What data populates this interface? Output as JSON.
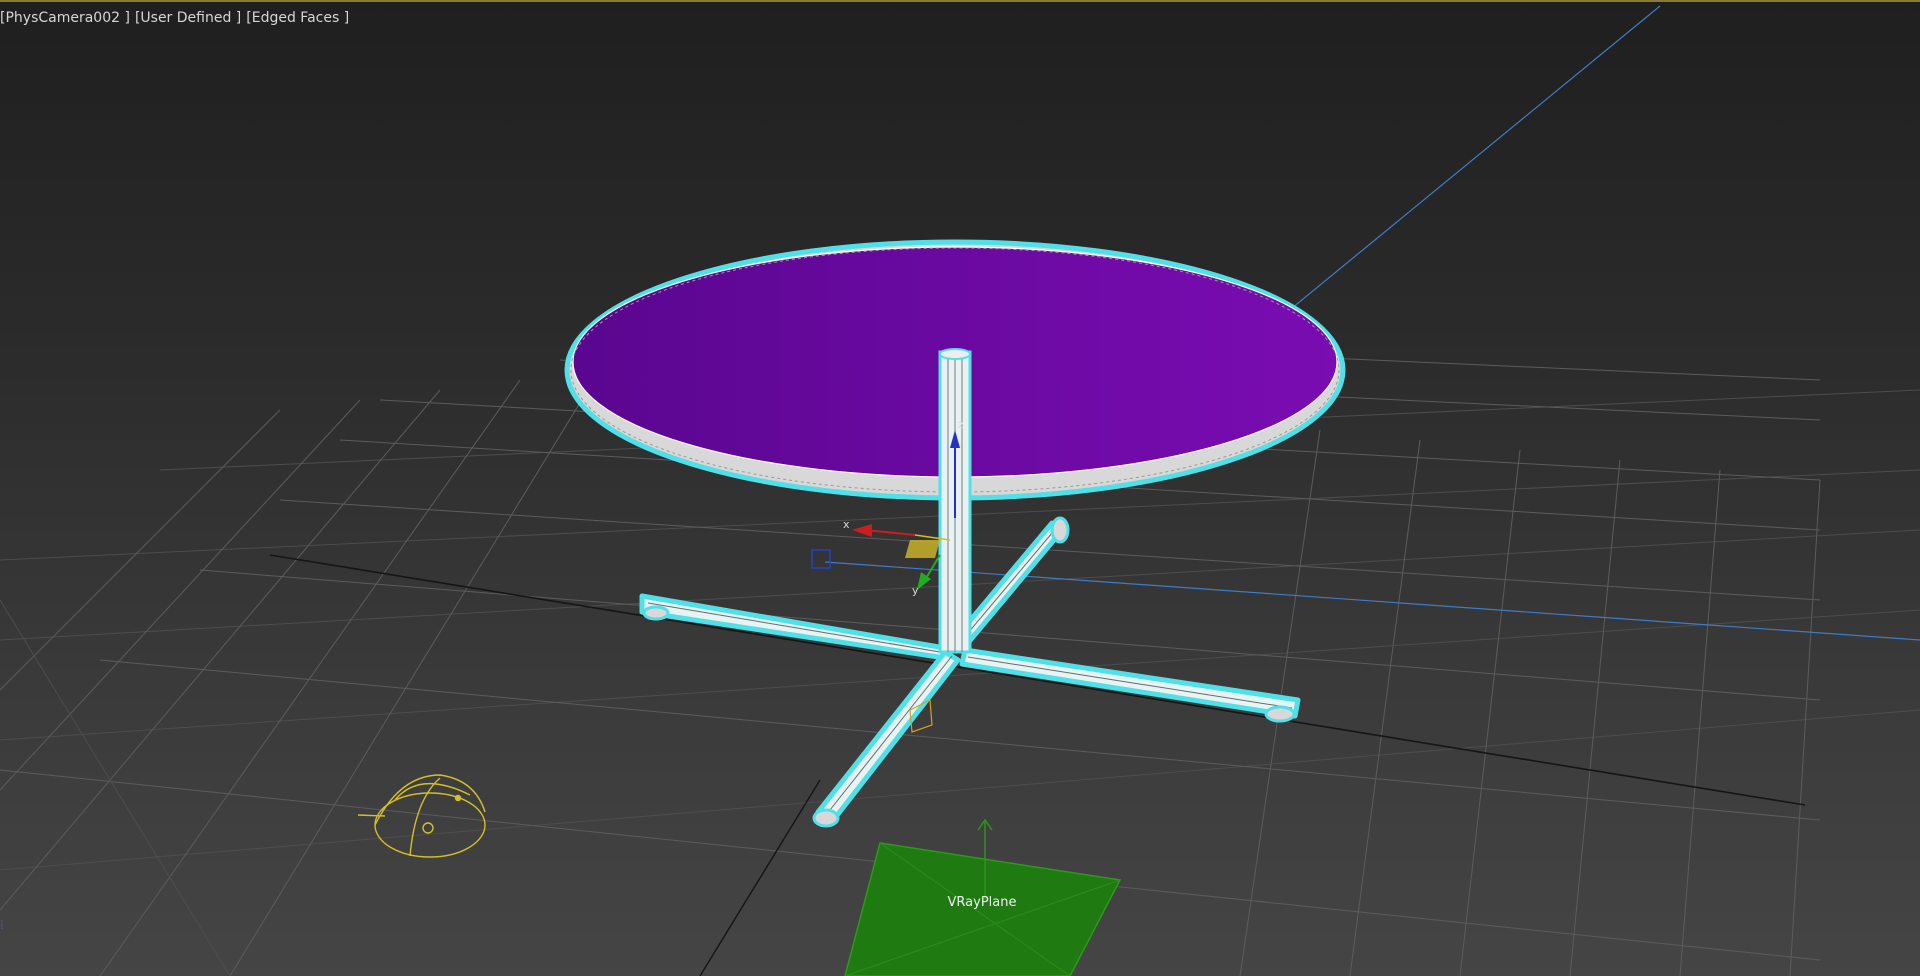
{
  "viewport": {
    "labels": {
      "camera": "[PhysCamera002 ]",
      "view": "[User Defined ]",
      "shading": "[Edged Faces ]"
    },
    "objects": {
      "vray_plane_label": "VRayPlane"
    },
    "gizmo": {
      "x_axis": "x",
      "y_axis": "y",
      "z_axis": "z"
    },
    "colors": {
      "selection_highlight": "#4fe0e8",
      "tabletop": "#7208a8",
      "vray_plane": "#1f7a12",
      "light_helper": "#d4c026",
      "grid": "#5c5c5c",
      "camera_line": "#3d7dc8"
    }
  }
}
